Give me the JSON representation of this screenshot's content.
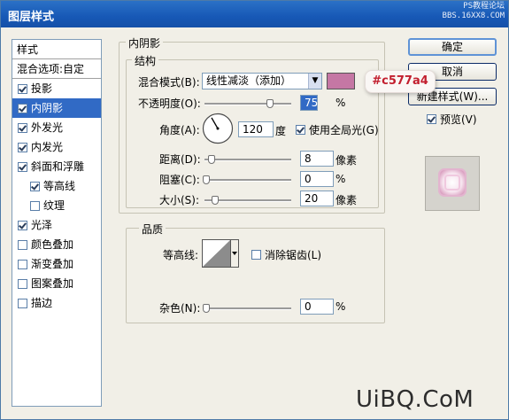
{
  "window": {
    "title": "图层样式",
    "watermark_line1": "PS教程论坛",
    "watermark_line2": "BBS.16XX8.COM"
  },
  "left_panel": {
    "header": "样式",
    "blend_options": "混合选项:自定",
    "items": [
      {
        "label": "投影",
        "checked": true
      },
      {
        "label": "内阴影",
        "checked": true,
        "selected": true
      },
      {
        "label": "外发光",
        "checked": true
      },
      {
        "label": "内发光",
        "checked": true
      },
      {
        "label": "斜面和浮雕",
        "checked": true
      },
      {
        "label": "等高线",
        "checked": true,
        "sub": true
      },
      {
        "label": "纹理",
        "checked": false,
        "sub": true
      },
      {
        "label": "光泽",
        "checked": true
      },
      {
        "label": "颜色叠加",
        "checked": false
      },
      {
        "label": "渐变叠加",
        "checked": false
      },
      {
        "label": "图案叠加",
        "checked": false
      },
      {
        "label": "描边",
        "checked": false
      }
    ]
  },
  "inner_shadow": {
    "group_title": "内阴影",
    "structure_title": "结构",
    "blend_mode_label": "混合模式(B):",
    "blend_mode_value": "线性减淡（添加）",
    "shadow_color": "#c577a4",
    "color_callout": "#c577a4",
    "opacity_label": "不透明度(O):",
    "opacity_value": "75",
    "opacity_unit": "%",
    "opacity_level": 0.75,
    "angle_label": "角度(A):",
    "angle_value": "120",
    "angle_unit": "度",
    "global_light_label": "使用全局光(G)",
    "global_light_checked": true,
    "distance_label": "距离(D):",
    "distance_value": "8",
    "distance_unit": "像素",
    "choke_label": "阻塞(C):",
    "choke_value": "0",
    "choke_unit": "%",
    "size_label": "大小(S):",
    "size_value": "20",
    "size_unit": "像素"
  },
  "quality": {
    "title": "品质",
    "contour_label": "等高线:",
    "antialias_label": "消除锯齿(L)",
    "antialias_checked": false,
    "noise_label": "杂色(N):",
    "noise_value": "0",
    "noise_unit": "%"
  },
  "buttons": {
    "ok": "确定",
    "cancel": "取消",
    "new_style": "新建样式(W)...",
    "preview": "预览(V)",
    "preview_checked": true
  },
  "brand": "UiBQ.CoM"
}
